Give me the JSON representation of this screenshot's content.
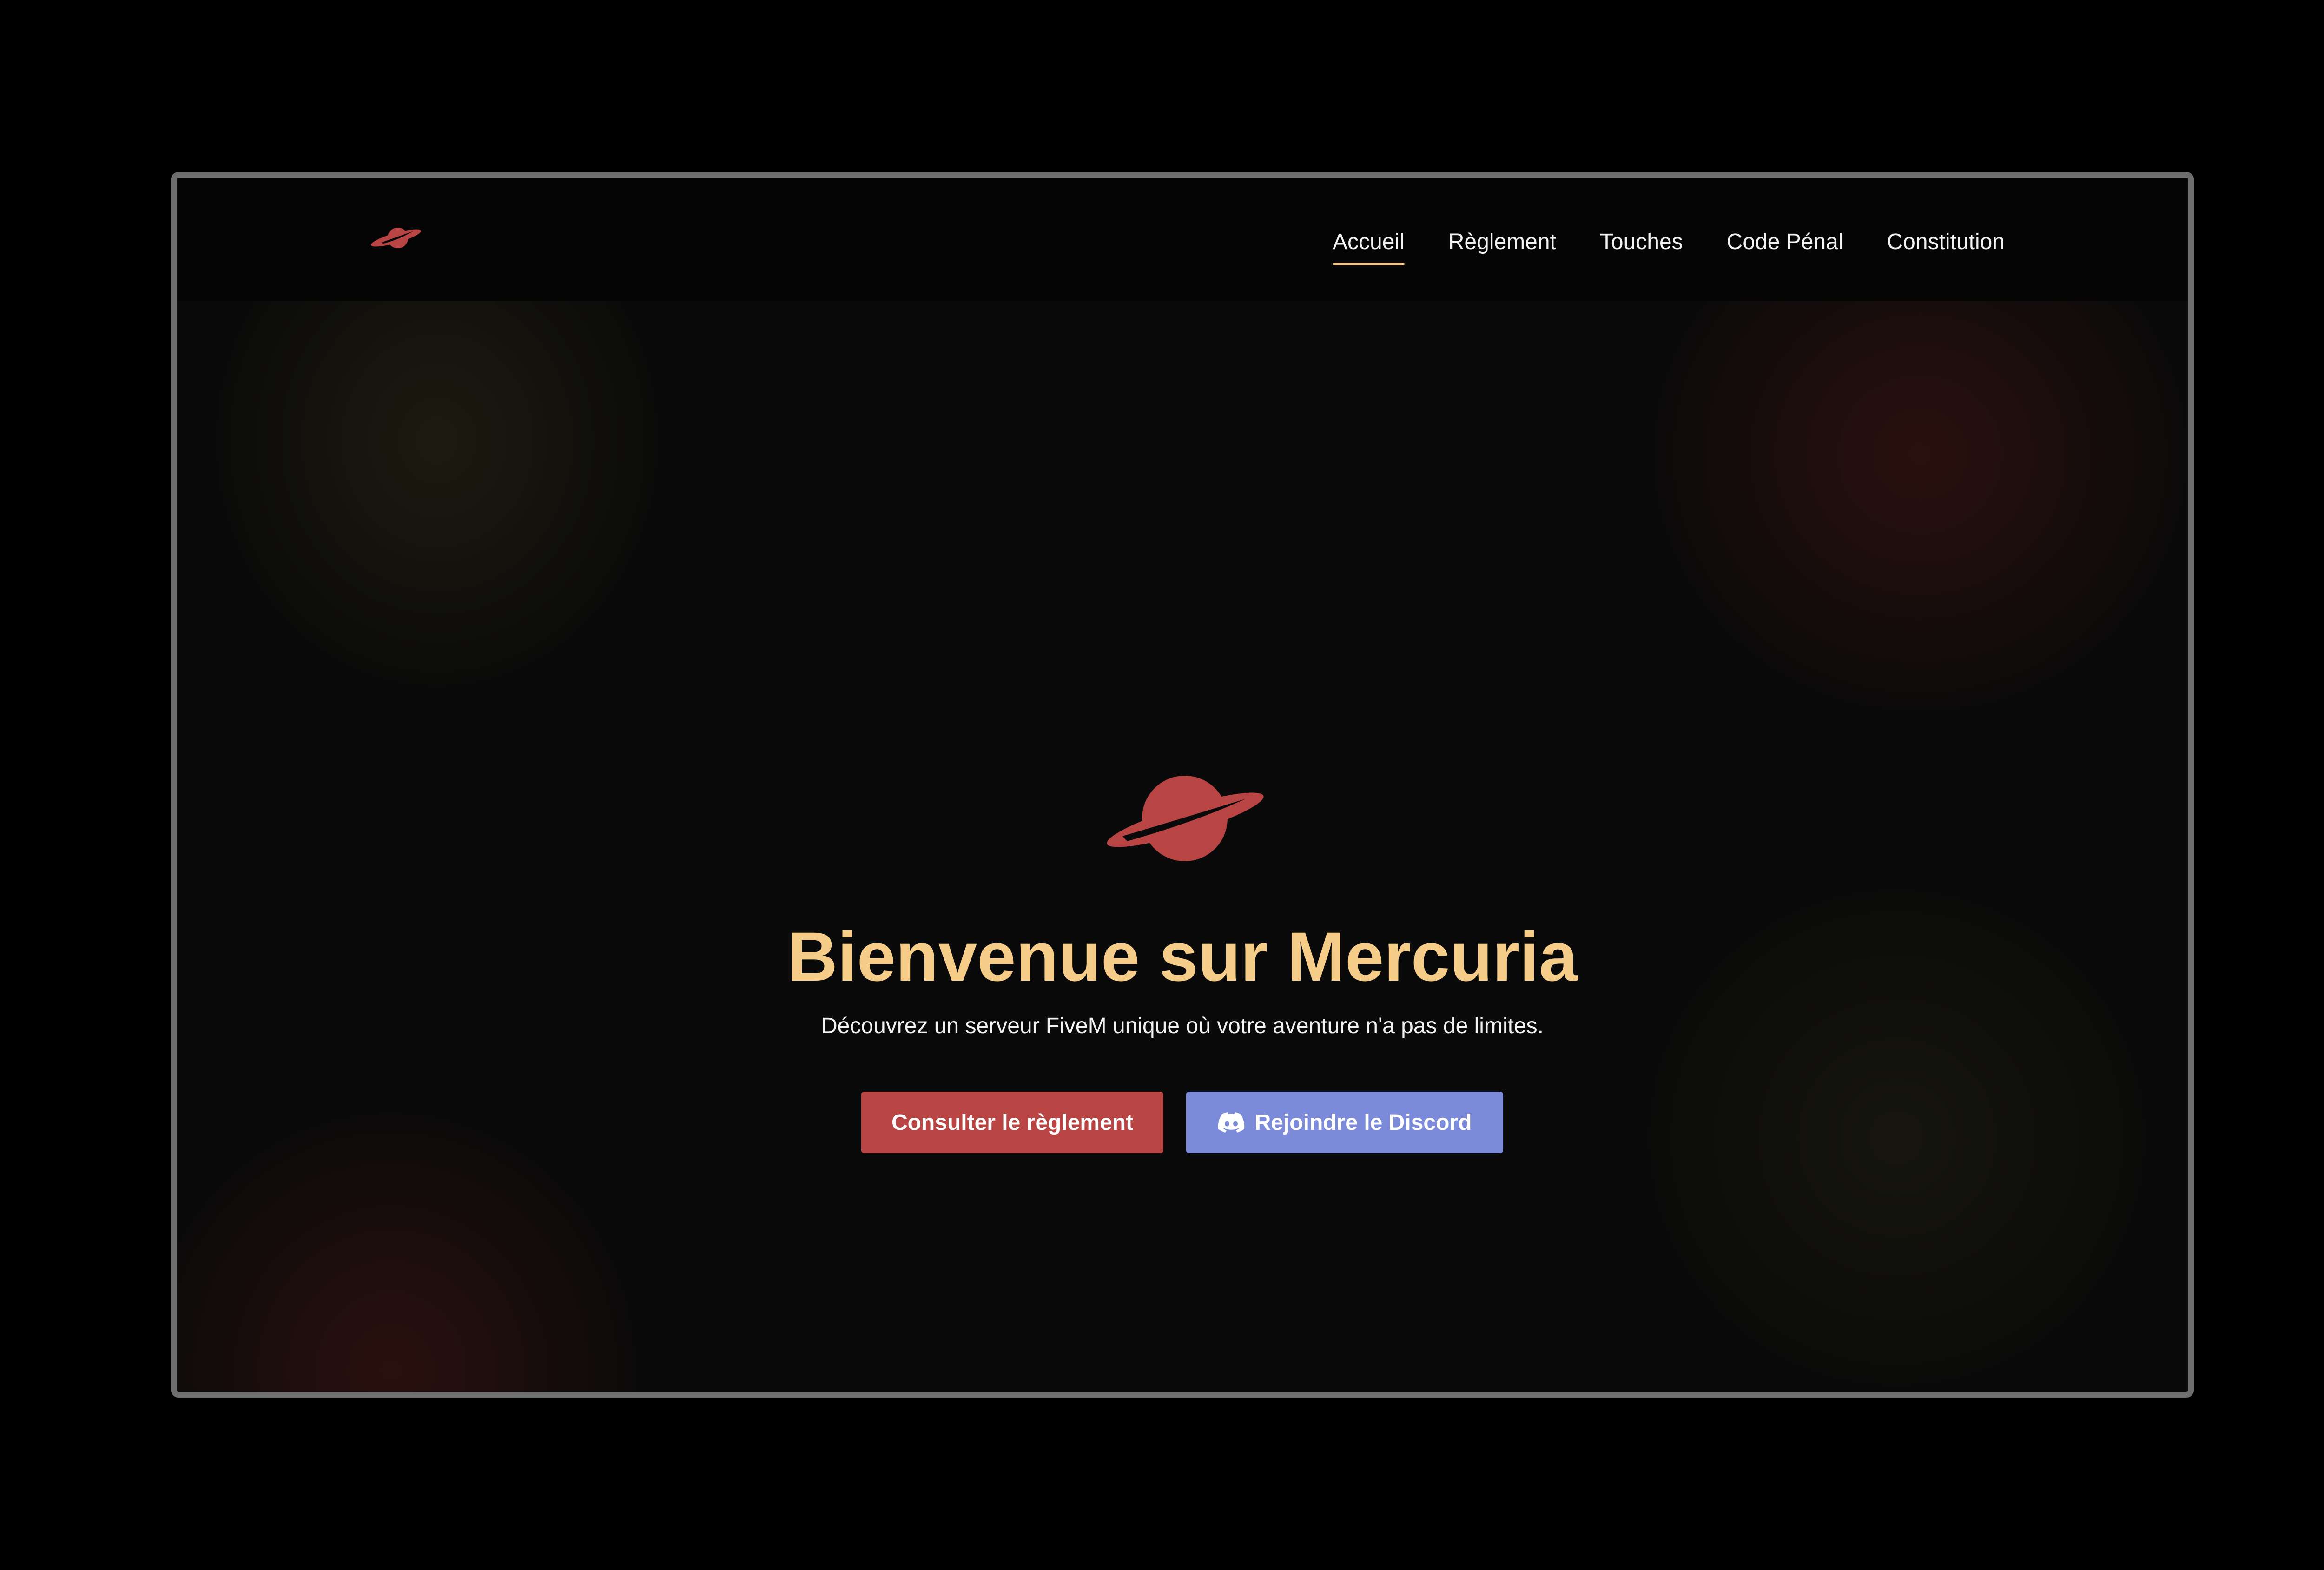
{
  "nav": {
    "links": [
      {
        "label": "Accueil",
        "active": true
      },
      {
        "label": "Règlement",
        "active": false
      },
      {
        "label": "Touches",
        "active": false
      },
      {
        "label": "Code Pénal",
        "active": false
      },
      {
        "label": "Constitution",
        "active": false
      }
    ],
    "logo_icon": "planet-icon"
  },
  "hero": {
    "logo_icon": "planet-icon",
    "title": "Bienvenue sur Mercuria",
    "subtitle": "Découvrez un serveur FiveM unique où votre aventure n'a pas de limites.",
    "buttons": {
      "rules_label": "Consulter le règlement",
      "discord_label": "Rejoindre le Discord",
      "discord_icon": "discord-icon"
    }
  },
  "colors": {
    "accent_red": "#b84444",
    "title_gold": "#f5cd89",
    "discord_blue": "#7b8bd9",
    "nav_underline": "#f2c98a"
  }
}
